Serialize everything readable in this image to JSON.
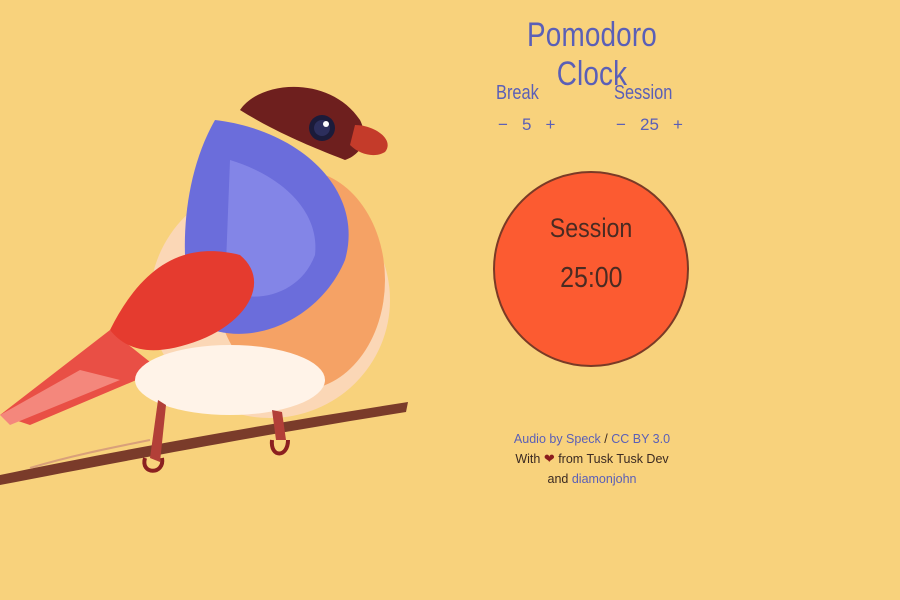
{
  "app": {
    "title": "Pomodoro Clock"
  },
  "break": {
    "label": "Break",
    "minus": "−",
    "value": "5",
    "plus": "+"
  },
  "session": {
    "label": "Session",
    "minus": "−",
    "value": "25",
    "plus": "+"
  },
  "timer": {
    "mode": "Session",
    "time": "25:00"
  },
  "credits": {
    "audio_by": "Audio by Speck",
    "slash": "/",
    "license": "CC BY 3.0",
    "with": "With",
    "heart_icon": "heart-icon",
    "from": "from Tusk Tusk Dev",
    "and": "and",
    "author": "diamonjohn"
  },
  "colors": {
    "background": "#f8d27c",
    "accent": "#5a5fb7",
    "dial": "#fc5b31"
  }
}
